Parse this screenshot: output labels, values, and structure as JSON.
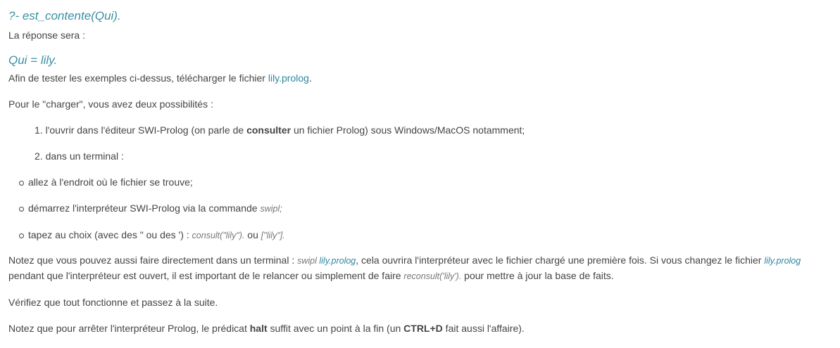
{
  "query": "?- est_contente(Qui).",
  "intro": "La réponse sera :",
  "answer": "Qui = lily.",
  "p1": {
    "pre": "Afin de tester les exemples ci-dessus, télécharger le fichier ",
    "link": "lily.prolog",
    "post": "."
  },
  "p2": "Pour le \"charger\", vous avez deux possibilités :",
  "ol": [
    {
      "num": "1.",
      "pre": "l'ouvrir dans l'éditeur SWI-Prolog (on parle de ",
      "bold": "consulter",
      "post": " un fichier Prolog) sous Windows/MacOS notamment;"
    },
    {
      "num": "2.",
      "text": "dans un terminal :"
    }
  ],
  "ul": [
    {
      "text": "allez à l'endroit où le fichier se trouve;"
    },
    {
      "text": "démarrez l'interpréteur SWI-Prolog via la commande ",
      "code": "swipl;"
    },
    {
      "text": "tapez au choix (avec des \" ou des ') : ",
      "code": "consult(\"lily\").",
      "mid": " ou ",
      "code2": "[\"lily\"]."
    }
  ],
  "p3": {
    "a": "Notez que vous pouvez aussi faire directement dans un terminal : ",
    "code": "swipl ",
    "link": "lily.prolog",
    "b": ", cela ouvrira l'interpréteur avec le fichier chargé une première fois. Si vous changez le fichier ",
    "link2": "lily.prolog",
    "c": " pendant que l'interpréteur est ouvert, il est important de le relancer ou simplement de faire ",
    "code2": "reconsult('lily').",
    "d": " pour mettre à jour la base de faits."
  },
  "p4": "Vérifiez que tout fonctionne et passez à la suite.",
  "p5": {
    "a": "Notez que pour arrêter l'interpréteur Prolog, le prédicat ",
    "b1": "halt",
    "b": " suffit avec un point à la fin (un ",
    "b2": "CTRL+D",
    "c": " fait aussi l'affaire)."
  }
}
